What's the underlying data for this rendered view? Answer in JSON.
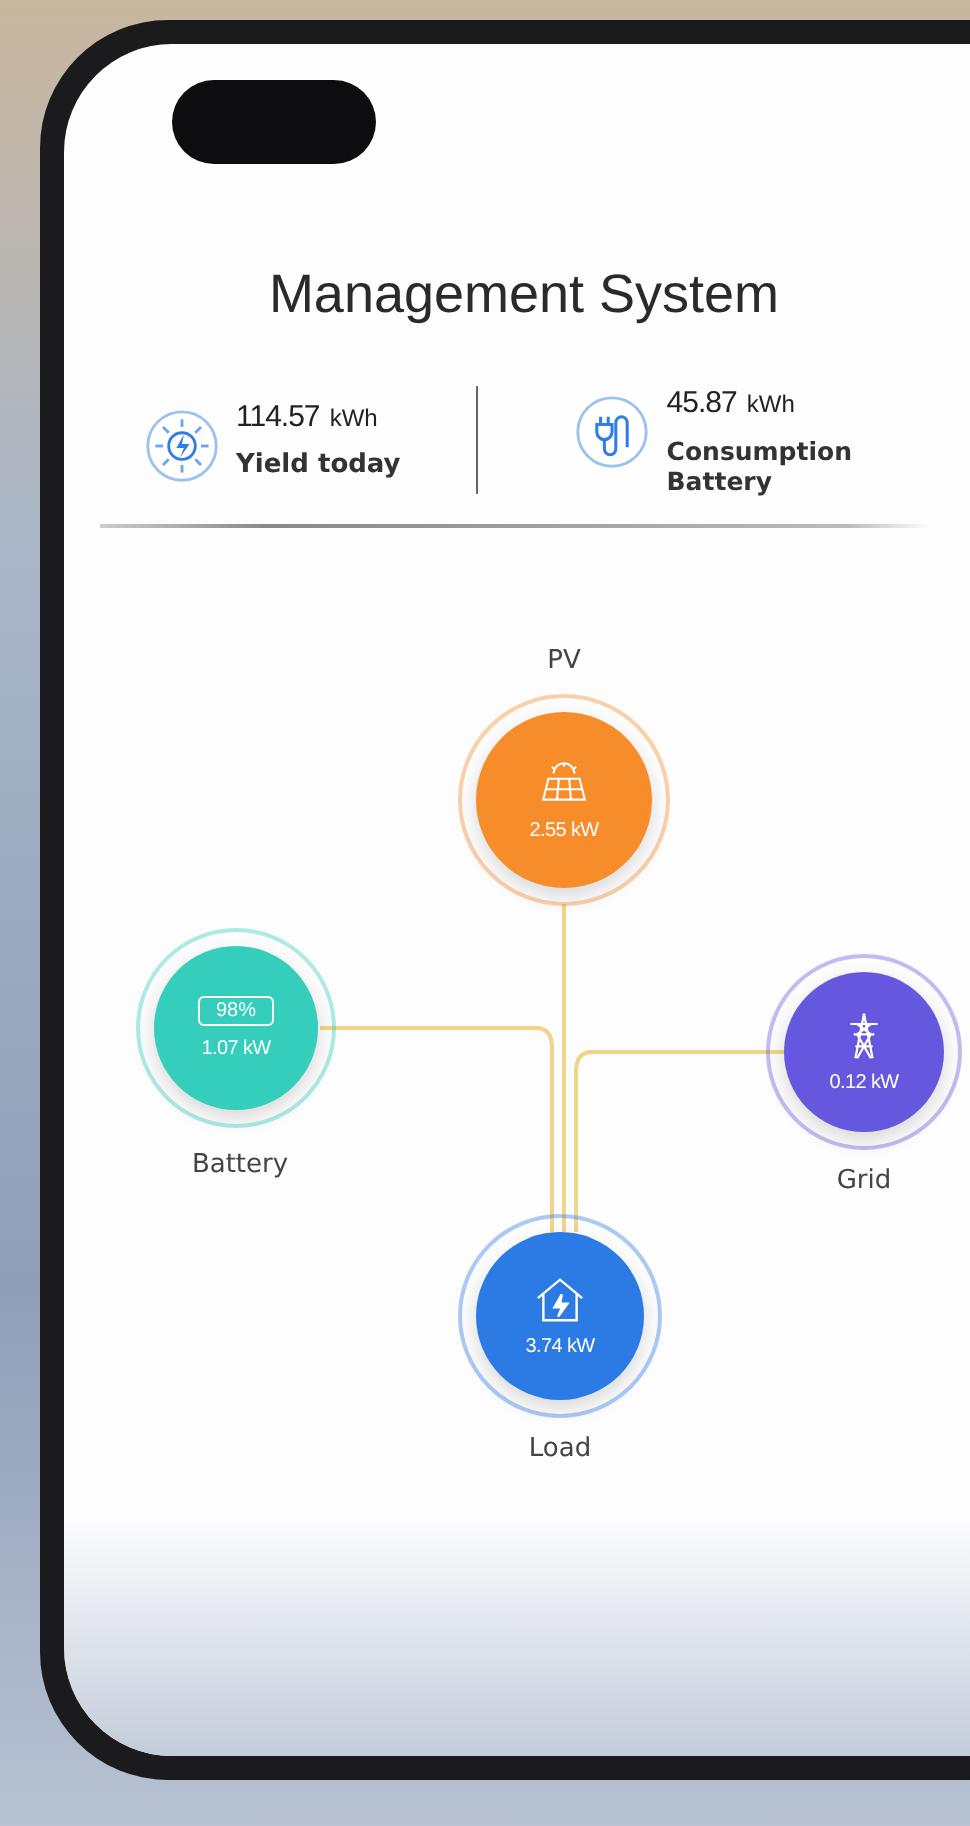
{
  "title": "Management System",
  "stats": [
    {
      "kind": "yield",
      "value": "114.57",
      "unit": "kWh",
      "label": "Yield today"
    },
    {
      "kind": "consumption",
      "value": "45.87",
      "unit": "kWh",
      "label": "Consumption Battery"
    }
  ],
  "nodes": [
    {
      "kind": "pv",
      "label": "PV",
      "reading": "2.55 kW",
      "color": "#f68d2a"
    },
    {
      "kind": "battery",
      "label": "Battery",
      "reading": "1.07 kW",
      "badge": "98%",
      "color": "#35cdbb"
    },
    {
      "kind": "grid",
      "label": "Grid",
      "reading": "0.12 kW",
      "color": "#6658de"
    },
    {
      "kind": "load",
      "label": "Load",
      "reading": "3.74 kW",
      "color": "#2c7be5"
    }
  ]
}
